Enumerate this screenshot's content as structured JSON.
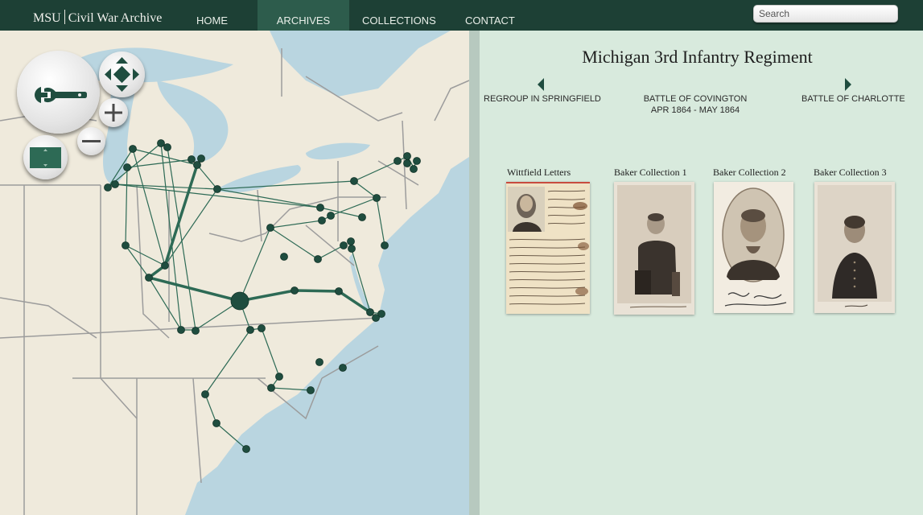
{
  "header": {
    "logo_left": "MSU",
    "logo_right": "Civil War Archive",
    "nav": [
      {
        "label": "HOME",
        "active": false
      },
      {
        "label": "ARCHIVES",
        "active": true
      },
      {
        "label": "COLLECTIONS",
        "active": false
      },
      {
        "label": "CONTACT",
        "active": false
      }
    ],
    "search": {
      "placeholder": "Search",
      "value": ""
    }
  },
  "map": {
    "controls": [
      "settings-wrench-icon",
      "pan-arrows-icon",
      "zoom-in-icon",
      "zoom-out-icon",
      "zoom-extent-icon"
    ],
    "colors": {
      "water": "#b9d5e0",
      "land": "#efeadc",
      "borders": "#9c9c9c",
      "route": "#2d6a55",
      "marker": "#1f4d3f"
    }
  },
  "detail": {
    "title": "Michigan 3rd Infantry Regiment",
    "previous_event": "REGROUP IN SPRINGFIELD",
    "current_event": {
      "name": "BATTLE OF COVINGTON",
      "dates": "APR 1864 - MAY 1864"
    },
    "next_event": "BATTLE OF CHARLOTTE",
    "collections": [
      {
        "label": "Wittfield Letters",
        "image": "letter-with-portrait"
      },
      {
        "label": "Baker Collection 1",
        "image": "seated-man-photograph"
      },
      {
        "label": "Baker Collection 2",
        "image": "oval-portrait-signed"
      },
      {
        "label": "Baker Collection 3",
        "image": "officer-portrait"
      }
    ]
  }
}
